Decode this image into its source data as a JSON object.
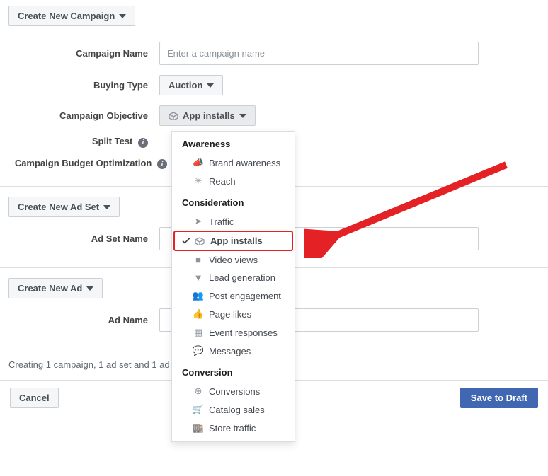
{
  "header": {
    "create_campaign_label": "Create New Campaign"
  },
  "campaign": {
    "name_label": "Campaign Name",
    "name_placeholder": "Enter a campaign name",
    "buying_type_label": "Buying Type",
    "buying_type_value": "Auction",
    "objective_label": "Campaign Objective",
    "objective_value": "App installs",
    "split_test_label": "Split Test",
    "budget_opt_label": "Campaign Budget Optimization"
  },
  "dropdown": {
    "groups": [
      {
        "title": "Awareness",
        "items": [
          {
            "icon": "megaphone",
            "label": "Brand awareness"
          },
          {
            "icon": "snowflake",
            "label": "Reach"
          }
        ]
      },
      {
        "title": "Consideration",
        "items": [
          {
            "icon": "cursor",
            "label": "Traffic"
          },
          {
            "icon": "box",
            "label": "App installs",
            "selected": true
          },
          {
            "icon": "video",
            "label": "Video views"
          },
          {
            "icon": "funnel",
            "label": "Lead generation"
          },
          {
            "icon": "people",
            "label": "Post engagement"
          },
          {
            "icon": "thumb",
            "label": "Page likes"
          },
          {
            "icon": "calendar",
            "label": "Event responses"
          },
          {
            "icon": "chat",
            "label": "Messages"
          }
        ]
      },
      {
        "title": "Conversion",
        "items": [
          {
            "icon": "globe",
            "label": "Conversions"
          },
          {
            "icon": "cart",
            "label": "Catalog sales"
          },
          {
            "icon": "store",
            "label": "Store traffic"
          }
        ]
      }
    ]
  },
  "adset": {
    "create_label": "Create New Ad Set",
    "name_label": "Ad Set Name"
  },
  "ad": {
    "create_label": "Create New Ad",
    "name_label": "Ad Name"
  },
  "footer": {
    "summary": "Creating 1 campaign, 1 ad set and 1 ad",
    "cancel": "Cancel",
    "save": "Save to Draft"
  }
}
